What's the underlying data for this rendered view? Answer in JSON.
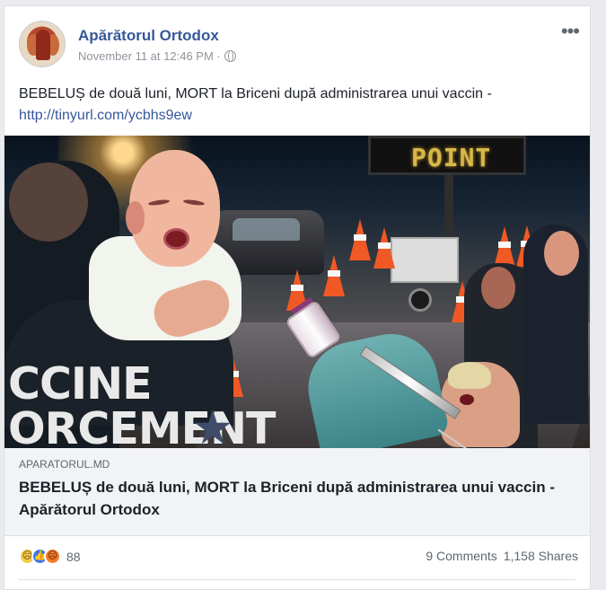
{
  "post": {
    "page_name": "Apărătorul Ortodox",
    "timestamp": "November 11 at 12:46 PM ·",
    "privacy_icon": "globe-icon",
    "more_icon": "more-options-icon",
    "text": "BEBELUȘ de două luni, MORT la Briceni după administrarea unui vaccin -",
    "link": "http://tinyurl.com/ycbhs9ew"
  },
  "image": {
    "sign_text": "POINT",
    "uniform_text": "CCINE\nORCEMENT"
  },
  "link_preview": {
    "domain": "APARATORUL.MD",
    "title": "BEBELUȘ de două luni, MORT la Briceni după administrarea unui vaccin - Apărătorul Ortodox"
  },
  "engagement": {
    "reaction_count": "88",
    "reaction_icons": [
      "sad-reaction-icon",
      "like-reaction-icon",
      "angry-reaction-icon"
    ],
    "comments": "9 Comments",
    "shares": "1,158 Shares"
  },
  "colors": {
    "link_blue": "#365899",
    "card_border": "#dddfe2",
    "preview_background": "#f2f3f5"
  }
}
